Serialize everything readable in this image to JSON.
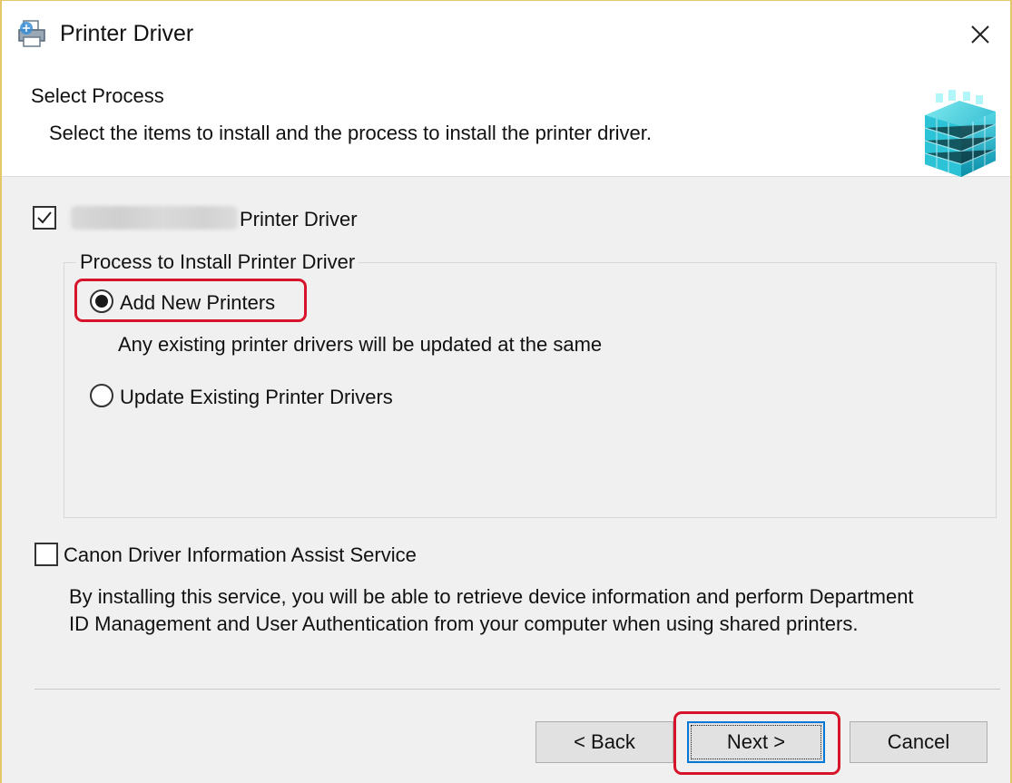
{
  "window": {
    "title": "Printer Driver"
  },
  "header": {
    "title": "Select Process",
    "description": "Select the items to install and the process to install the printer driver."
  },
  "printer_driver_item": {
    "checked": true,
    "label": "Printer Driver"
  },
  "process_group": {
    "legend": "Process to Install Printer Driver",
    "options": [
      {
        "label": "Add New Printers",
        "selected": true,
        "note": "Any existing printer drivers will be updated at the same"
      },
      {
        "label": "Update Existing Printer Drivers",
        "selected": false
      }
    ]
  },
  "assist_service": {
    "checked": false,
    "label": "Canon Driver Information Assist Service",
    "description_line1": "By installing this service, you will be able to retrieve device information and perform Department",
    "description_line2": "ID Management and User Authentication from your computer when using shared printers."
  },
  "buttons": {
    "back": "< Back",
    "next": "Next >",
    "cancel": "Cancel"
  },
  "colors": {
    "highlight": "#d7142b",
    "focus_border": "#0078d7",
    "window_border": "#e3c76a"
  }
}
